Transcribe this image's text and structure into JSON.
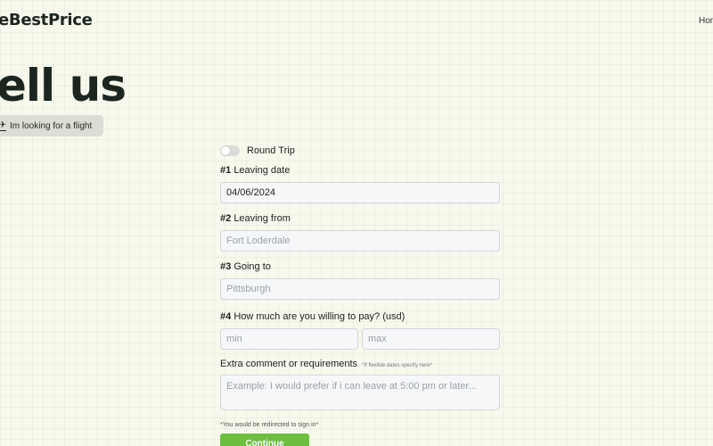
{
  "header": {
    "logo_text": "eBestPrice",
    "nav_home": "Hon"
  },
  "hero": {
    "title": "ell us",
    "mode_chip_label": "Im looking for a flight",
    "mode_icon": "plane-icon"
  },
  "form": {
    "round_trip_label": "Round Trip",
    "round_trip_checked": false,
    "q1_number": "#1",
    "q1_label": "Leaving date",
    "leaving_date_value": "04/06/2024",
    "q2_number": "#2",
    "q2_label": "Leaving from",
    "leaving_from_placeholder": "Fort Loderdale",
    "q3_number": "#3",
    "q3_label": "Going to",
    "going_to_placeholder": "Pittsburgh",
    "q4_number": "#4",
    "q4_label": "How much are you willing to pay? (usd)",
    "min_placeholder": "min",
    "max_placeholder": "max",
    "extra_label": "Extra comment or requirements",
    "extra_hint": "*If flexible dates specify here*",
    "extra_placeholder": "Example: I would prefer if i can leave at 5:00 pm or later...",
    "redirect_note": "*You would be redirected to sign in*",
    "continue_label": "Continue"
  },
  "colors": {
    "background": "#f7f9ec",
    "accent_green": "#6cbf3f",
    "text_dark": "#1c2620"
  }
}
